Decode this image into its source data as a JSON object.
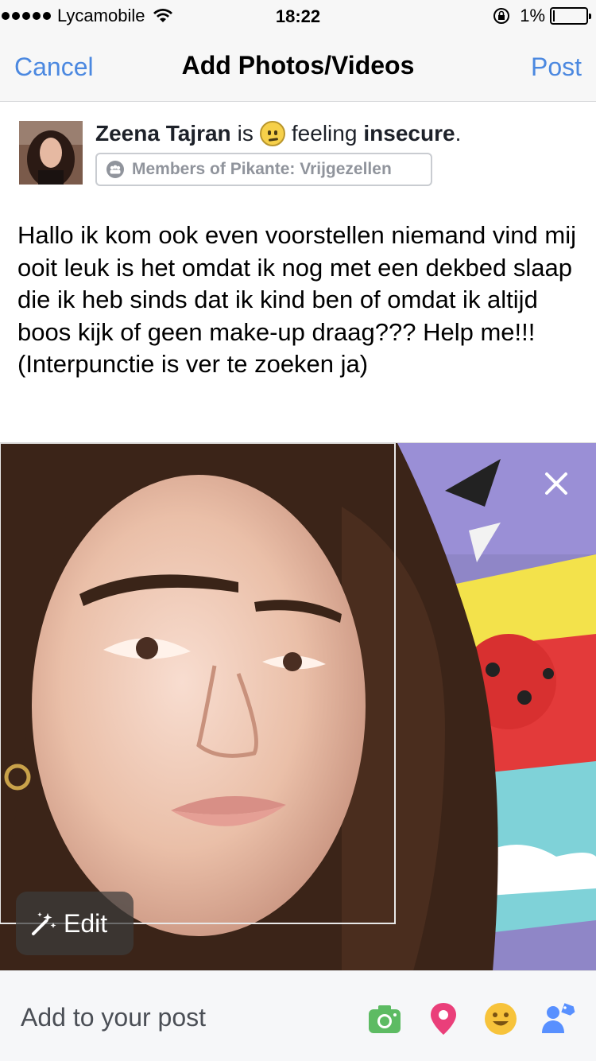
{
  "status_bar": {
    "carrier": "Lycamobile",
    "time": "18:22",
    "battery": "1%"
  },
  "nav": {
    "cancel": "Cancel",
    "title": "Add Photos/Videos",
    "post": "Post"
  },
  "author": {
    "name": "Zeena Tajran",
    "is": "is",
    "feeling_word": "feeling",
    "feeling": "insecure",
    "period": ".",
    "audience": "Members of Pikante: Vrijgezellen"
  },
  "post_text": "Hallo ik kom ook even voorstellen niemand vind mij ooit leuk is het omdat ik nog met een dekbed slaap die ik heb sinds dat ik kind ben of omdat ik altijd boos kijk of geen make-up draag??? Help me!!! (Interpunctie is ver te zoeken ja)",
  "photo": {
    "edit_label": "Edit"
  },
  "bottom": {
    "add_to_post": "Add to your post"
  },
  "colors": {
    "accent": "#4b88e0",
    "camera": "#5dbb63",
    "location": "#ea3f7a",
    "feeling": "#f7c33b",
    "tag": "#5890ff"
  }
}
